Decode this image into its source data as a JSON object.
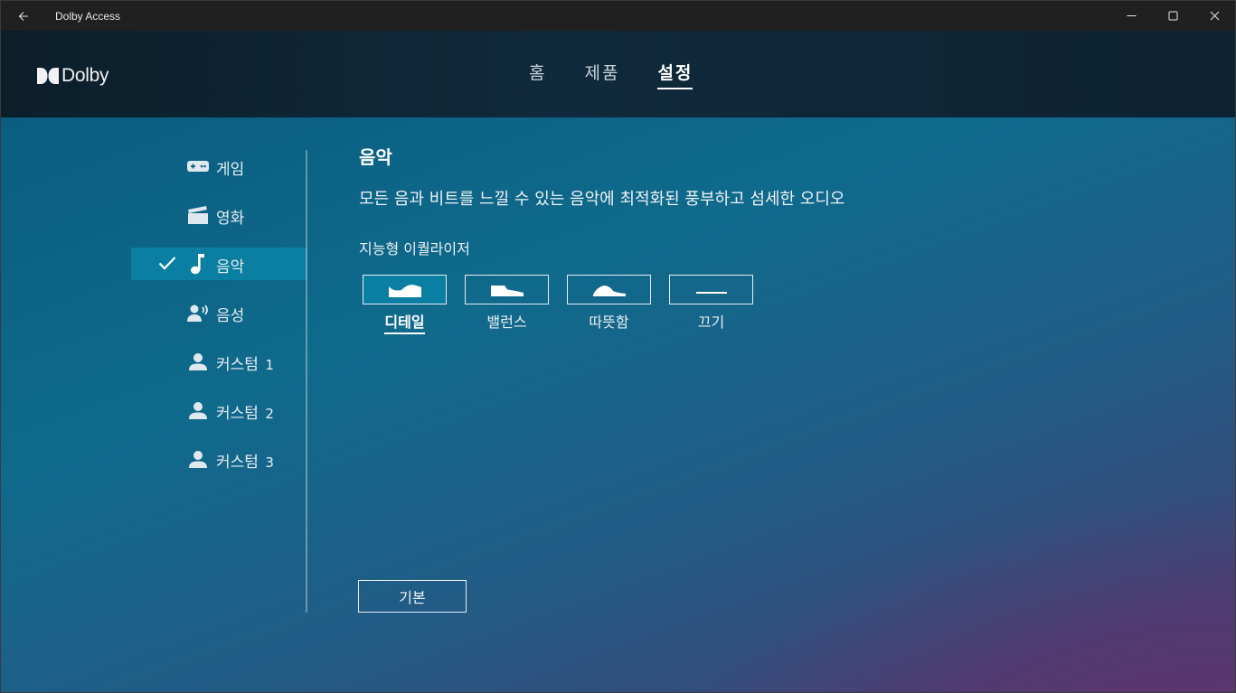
{
  "window": {
    "title": "Dolby Access"
  },
  "header": {
    "logo_text": "Dolby",
    "tabs": [
      {
        "label": "홈"
      },
      {
        "label": "제품"
      },
      {
        "label": "설정",
        "active": true
      }
    ]
  },
  "sidebar": {
    "items": [
      {
        "label": "게임",
        "icon": "gamepad-icon"
      },
      {
        "label": "영화",
        "icon": "clapperboard-icon"
      },
      {
        "label": "음악",
        "icon": "music-note-icon",
        "active": true
      },
      {
        "label": "음성",
        "icon": "voice-icon"
      },
      {
        "label": "커스텀",
        "num": "1",
        "icon": "person-icon"
      },
      {
        "label": "커스텀",
        "num": "2",
        "icon": "person-icon"
      },
      {
        "label": "커스텀",
        "num": "3",
        "icon": "person-icon"
      }
    ]
  },
  "content": {
    "title": "음악",
    "description": "모든 음과 비트를 느낄 수 있는 음악에 최적화된 풍부하고 섬세한 오디오",
    "eq_label": "지능형 이퀄라이저",
    "eq_options": [
      {
        "label": "디테일",
        "active": true
      },
      {
        "label": "밸런스"
      },
      {
        "label": "따뜻함"
      },
      {
        "label": "끄기"
      }
    ],
    "default_button": "기본"
  },
  "colors": {
    "accent": "#0b7fa1",
    "title_bar": "#202020",
    "header_bg": "#0f2a3c"
  }
}
